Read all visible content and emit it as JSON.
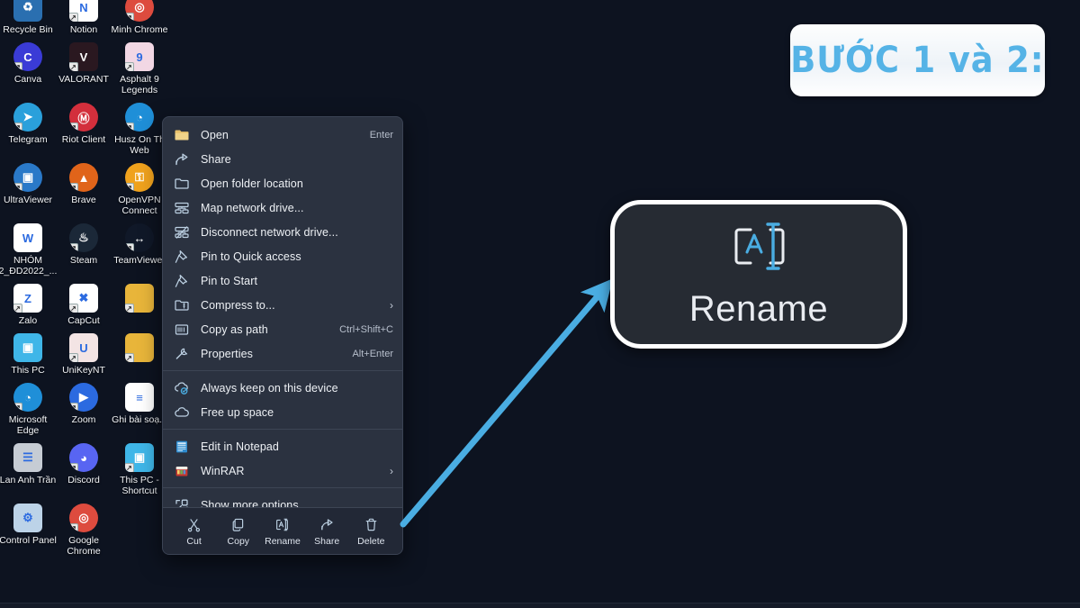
{
  "desktop": {
    "background_color": "#0d1320",
    "icons": [
      {
        "label": "Recycle Bin",
        "icon": "recycle-bin-icon",
        "color": "#2a6fb0",
        "glyph": "♻",
        "shortcut": false
      },
      {
        "label": "Notion",
        "icon": "notion-icon",
        "color": "#ffffff",
        "glyph": "N",
        "shortcut": true
      },
      {
        "label": "Minh Chrome",
        "icon": "chrome-icon",
        "color": "#dd4b3e",
        "glyph": "◎",
        "shortcut": true
      },
      {
        "label": "Canva",
        "icon": "canva-icon",
        "color": "#3a3bd6",
        "glyph": "C",
        "shortcut": true
      },
      {
        "label": "VALORANT",
        "icon": "valorant-icon",
        "color": "#2a1820",
        "glyph": "V",
        "shortcut": true
      },
      {
        "label": "Asphalt 9 Legends",
        "icon": "asphalt9-icon",
        "color": "#f2d7e4",
        "glyph": "9",
        "shortcut": true
      },
      {
        "label": "Telegram",
        "icon": "telegram-icon",
        "color": "#2aa0db",
        "glyph": "➤",
        "shortcut": true
      },
      {
        "label": "Riot Client",
        "icon": "riot-client-icon",
        "color": "#d32f3c",
        "glyph": "Ⓜ",
        "shortcut": true
      },
      {
        "label": "Husz On Th Web",
        "icon": "edge-icon",
        "color": "#1f8fd8",
        "glyph": "◔",
        "shortcut": true
      },
      {
        "label": "UltraViewer",
        "icon": "ultraviewer-icon",
        "color": "#2a79c8",
        "glyph": "▣",
        "shortcut": true
      },
      {
        "label": "Brave",
        "icon": "brave-icon",
        "color": "#e0641a",
        "glyph": "▲",
        "shortcut": true
      },
      {
        "label": "OpenVPN Connect",
        "icon": "openvpn-icon",
        "color": "#f0a21d",
        "glyph": "⚿",
        "shortcut": true
      },
      {
        "label": "NHÓM 2_ĐD2022_...",
        "icon": "word-document-icon",
        "color": "#ffffff",
        "glyph": "W",
        "shortcut": false
      },
      {
        "label": "Steam",
        "icon": "steam-icon",
        "color": "#1b2838",
        "glyph": "♨",
        "shortcut": true
      },
      {
        "label": "TeamViewer",
        "icon": "teamviewer-icon",
        "color": "#101828",
        "glyph": "↔",
        "shortcut": true
      },
      {
        "label": "Zalo",
        "icon": "zalo-icon",
        "color": "#ffffff",
        "glyph": "Z",
        "shortcut": true
      },
      {
        "label": "CapCut",
        "icon": "capcut-icon",
        "color": "#ffffff",
        "glyph": "✖",
        "shortcut": true
      },
      {
        "label": "",
        "icon": "folder-icon",
        "color": "#e8b53a",
        "glyph": "",
        "shortcut": true
      },
      {
        "label": "This PC",
        "icon": "this-pc-icon",
        "color": "#3fb6e8",
        "glyph": "▣",
        "shortcut": false
      },
      {
        "label": "UniKeyNT",
        "icon": "unikeynt-icon",
        "color": "#f3e4e4",
        "glyph": "U",
        "shortcut": true
      },
      {
        "label": "",
        "icon": "folder-icon",
        "color": "#e8b53a",
        "glyph": "",
        "shortcut": true
      },
      {
        "label": "Microsoft Edge",
        "icon": "edge-icon",
        "color": "#1f8fd8",
        "glyph": "◔",
        "shortcut": true
      },
      {
        "label": "Zoom",
        "icon": "zoom-icon",
        "color": "#2b6ae0",
        "glyph": "▶",
        "shortcut": true
      },
      {
        "label": "Ghi bài soạ...",
        "icon": "text-document-icon",
        "color": "#ffffff",
        "glyph": "≡",
        "shortcut": false
      },
      {
        "label": "Lan Anh Trần",
        "icon": "contact-folder-icon",
        "color": "#c6ccd4",
        "glyph": "☰",
        "shortcut": false
      },
      {
        "label": "Discord",
        "icon": "discord-icon",
        "color": "#5865f2",
        "glyph": "◕",
        "shortcut": true
      },
      {
        "label": "This PC - Shortcut",
        "icon": "this-pc-shortcut-icon",
        "color": "#3fb6e8",
        "glyph": "▣",
        "shortcut": true
      },
      {
        "label": "Control Panel",
        "icon": "control-panel-icon",
        "color": "#bcd3e8",
        "glyph": "⚙",
        "shortcut": false
      },
      {
        "label": "Google Chrome",
        "icon": "chrome-icon",
        "color": "#dd4b3e",
        "glyph": "◎",
        "shortcut": true
      }
    ]
  },
  "context_menu": {
    "background_color": "#2b3240",
    "items": [
      {
        "label": "Open",
        "icon": "folder-open-icon",
        "accel": "Enter",
        "submenu": false,
        "sep_after": false
      },
      {
        "label": "Share",
        "icon": "share-icon",
        "accel": "",
        "submenu": false,
        "sep_after": false
      },
      {
        "label": "Open folder location",
        "icon": "folder-icon",
        "accel": "",
        "submenu": false,
        "sep_after": false
      },
      {
        "label": "Map network drive...",
        "icon": "map-network-drive-icon",
        "accel": "",
        "submenu": false,
        "sep_after": false
      },
      {
        "label": "Disconnect network drive...",
        "icon": "disconnect-network-drive-icon",
        "accel": "",
        "submenu": false,
        "sep_after": false
      },
      {
        "label": "Pin to Quick access",
        "icon": "pin-icon",
        "accel": "",
        "submenu": false,
        "sep_after": false
      },
      {
        "label": "Pin to Start",
        "icon": "pin-icon",
        "accel": "",
        "submenu": false,
        "sep_after": false
      },
      {
        "label": "Compress to...",
        "icon": "compress-icon",
        "accel": "",
        "submenu": true,
        "sep_after": false
      },
      {
        "label": "Copy as path",
        "icon": "copy-as-path-icon",
        "accel": "Ctrl+Shift+C",
        "submenu": false,
        "sep_after": false
      },
      {
        "label": "Properties",
        "icon": "properties-icon",
        "accel": "Alt+Enter",
        "submenu": false,
        "sep_after": true
      },
      {
        "label": "Always keep on this device",
        "icon": "cloud-keep-icon",
        "accel": "",
        "submenu": false,
        "sep_after": false
      },
      {
        "label": "Free up space",
        "icon": "cloud-icon",
        "accel": "",
        "submenu": false,
        "sep_after": true
      },
      {
        "label": "Edit in Notepad",
        "icon": "notepad-icon",
        "accel": "",
        "submenu": false,
        "sep_after": false
      },
      {
        "label": "WinRAR",
        "icon": "winrar-icon",
        "accel": "",
        "submenu": true,
        "sep_after": true
      },
      {
        "label": "Show more options",
        "icon": "show-more-options-icon",
        "accel": "",
        "submenu": false,
        "sep_after": false
      }
    ],
    "command_bar": [
      {
        "label": "Cut",
        "icon": "cut-icon"
      },
      {
        "label": "Copy",
        "icon": "copy-icon"
      },
      {
        "label": "Rename",
        "icon": "rename-icon"
      },
      {
        "label": "Share",
        "icon": "share-icon"
      },
      {
        "label": "Delete",
        "icon": "delete-icon"
      }
    ]
  },
  "callout": {
    "label": "Rename",
    "icon": "rename-icon",
    "border_color": "#ffffff",
    "background_color": "#262b33"
  },
  "annotation": {
    "arrow_color": "#4aade2",
    "banner_text": "BƯỚC 1 và 2:",
    "banner_text_color": "#55b3e6",
    "banner_background_color": "#ffffff"
  }
}
